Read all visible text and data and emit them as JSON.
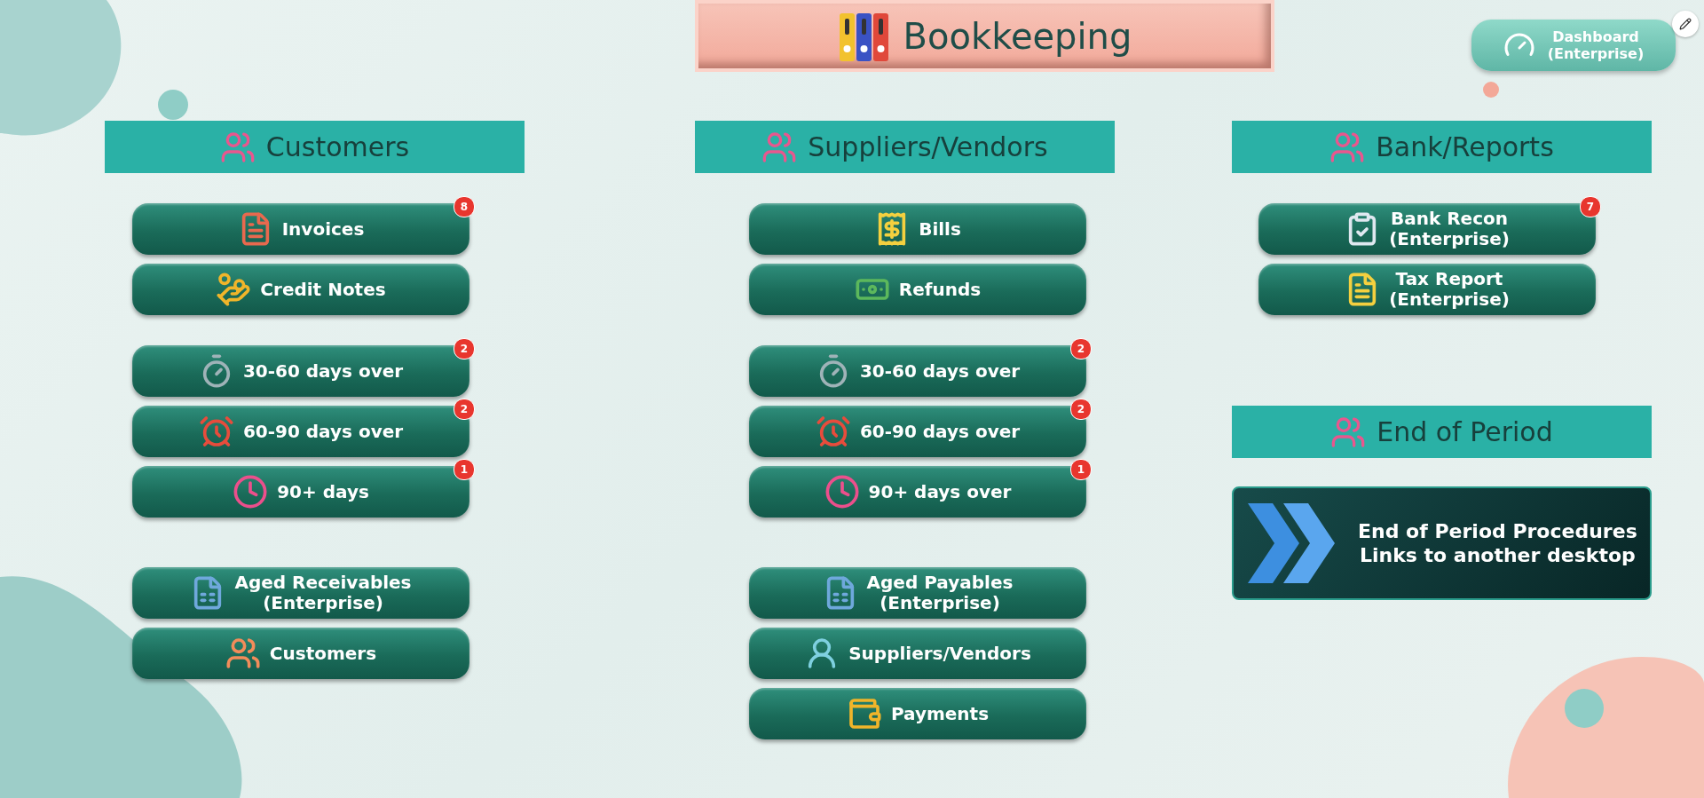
{
  "title": "Bookkeeping",
  "dashboard_button": {
    "label": "Dashboard\n(Enterprise)"
  },
  "columns": [
    {
      "sections": [
        {
          "heading": "Customers",
          "groups": [
            {
              "buttons": [
                {
                  "label": "Invoices",
                  "badge": "8"
                },
                {
                  "label": "Credit Notes"
                }
              ]
            },
            {
              "buttons": [
                {
                  "label": "30-60 days over",
                  "badge": "2"
                },
                {
                  "label": "60-90 days over",
                  "badge": "2"
                },
                {
                  "label": "90+ days",
                  "badge": "1"
                }
              ]
            },
            {
              "buttons": [
                {
                  "label": "Aged Receivables\n(Enterprise)"
                },
                {
                  "label": "Customers"
                }
              ]
            }
          ]
        }
      ]
    },
    {
      "sections": [
        {
          "heading": "Suppliers/Vendors",
          "groups": [
            {
              "buttons": [
                {
                  "label": "Bills"
                },
                {
                  "label": "Refunds"
                }
              ]
            },
            {
              "buttons": [
                {
                  "label": "30-60 days over",
                  "badge": "2"
                },
                {
                  "label": "60-90 days over",
                  "badge": "2"
                },
                {
                  "label": "90+ days over",
                  "badge": "1"
                }
              ]
            },
            {
              "buttons": [
                {
                  "label": "Aged Payables\n(Enterprise)"
                },
                {
                  "label": "Suppliers/Vendors"
                },
                {
                  "label": "Payments"
                }
              ]
            }
          ]
        }
      ]
    },
    {
      "sections": [
        {
          "heading": "Bank/Reports",
          "groups": [
            {
              "buttons": [
                {
                  "label": "Bank Recon\n(Enterprise)",
                  "badge": "7"
                },
                {
                  "label": "Tax Report\n(Enterprise)"
                }
              ]
            }
          ]
        },
        {
          "heading": "End of Period",
          "card": {
            "label": "End of Period Procedures\nLinks to another desktop"
          }
        }
      ]
    }
  ]
}
